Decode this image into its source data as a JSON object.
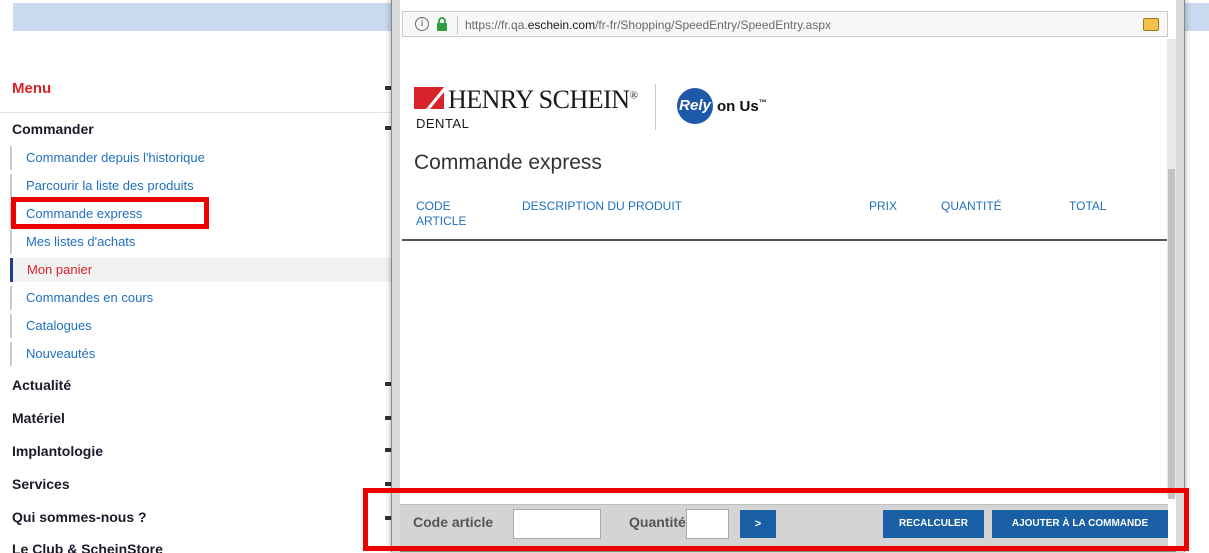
{
  "sidebar": {
    "menu_title": "Menu",
    "sections": {
      "commander": "Commander",
      "actualite": "Actualité",
      "materiel": "Matériel",
      "implantologie": "Implantologie",
      "services": "Services",
      "qui": "Qui sommes-nous ?",
      "club": "Le Club & ScheinStore"
    },
    "items": [
      {
        "label": "Commander depuis l'historique"
      },
      {
        "label": "Parcourir la liste des produits"
      },
      {
        "label": "Commande express"
      },
      {
        "label": "Mes listes d'achats"
      },
      {
        "label": "Mon panier"
      },
      {
        "label": "Commandes en cours"
      },
      {
        "label": "Catalogues"
      },
      {
        "label": "Nouveautés"
      }
    ]
  },
  "popup": {
    "url_prefix": "https://fr.qa.",
    "url_domain": "eschein.com",
    "url_path": "/fr-fr/Shopping/SpeedEntry/SpeedEntry.aspx",
    "logo": {
      "brand": "HENRY SCHEIN",
      "registered": "®",
      "sub": "DENTAL",
      "rely_badge": "Rely",
      "rely_text": "on Us",
      "tm": "™"
    },
    "title": "Commande express",
    "columns": {
      "code": "CODE ARTICLE",
      "description": "DESCRIPTION DU PRODUIT",
      "prix": "PRIX",
      "quantite": "QUANTITÉ",
      "total": "TOTAL"
    },
    "footer": {
      "code_label": "Code article",
      "code_value": "",
      "quantite_label": "Quantité",
      "quantite_value": "",
      "go_label": ">",
      "recalc_label": "RECALCULER",
      "add_label": "AJOUTER À LA COMMANDE"
    }
  },
  "colors": {
    "accent_red": "#d9232b",
    "link_blue": "#1f6fbf",
    "button_blue": "#1a5fa5",
    "highlight": "#ef0000"
  }
}
